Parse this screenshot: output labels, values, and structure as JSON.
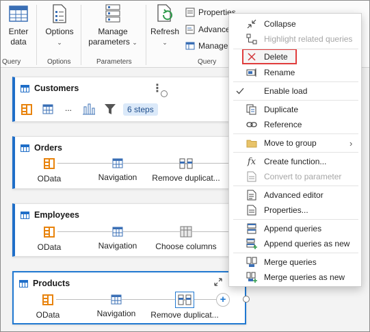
{
  "ribbon": {
    "enter_data": "Enter\ndata",
    "group_query_left": "Query",
    "options": "Options",
    "group_options": "Options",
    "manage_parameters": "Manage\nparameters",
    "group_parameters": "Parameters",
    "refresh": "Refresh",
    "properties": "Properties",
    "advanced": "Advanced",
    "manage": "Manage",
    "group_query": "Query"
  },
  "queries": [
    {
      "name": "Customers",
      "badge": "6 steps",
      "dots": "..."
    },
    {
      "name": "Orders",
      "steps": [
        "OData",
        "Navigation",
        "Remove duplicat..."
      ]
    },
    {
      "name": "Employees",
      "steps": [
        "OData",
        "Navigation",
        "Choose columns"
      ]
    },
    {
      "name": "Products",
      "steps": [
        "OData",
        "Navigation",
        "Remove duplicat..."
      ]
    }
  ],
  "menu": {
    "collapse": "Collapse",
    "highlight": "Highlight related queries",
    "delete": "Delete",
    "rename": "Rename",
    "enable_load": "Enable load",
    "duplicate": "Duplicate",
    "reference": "Reference",
    "move_to_group": "Move to group",
    "create_function": "Create function...",
    "convert_to_parameter": "Convert to parameter",
    "advanced_editor": "Advanced editor",
    "properties": "Properties...",
    "append_queries": "Append queries",
    "append_queries_new": "Append queries as new",
    "merge_queries": "Merge queries",
    "merge_queries_new": "Merge queries as new"
  },
  "colors": {
    "accent": "#1f6ec8",
    "orange": "#e8830c",
    "highlight_border": "#e03c3c"
  }
}
